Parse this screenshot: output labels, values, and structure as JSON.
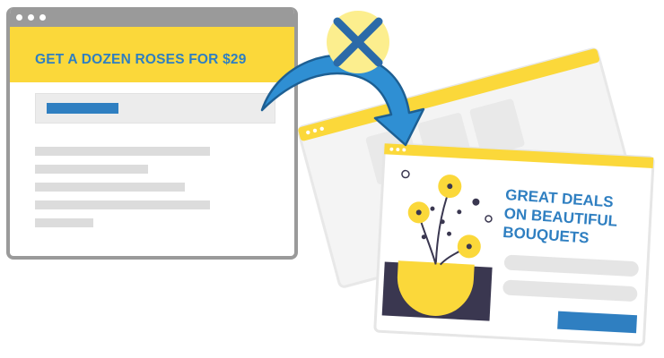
{
  "ad": {
    "headline": "GET A DOZEN ROSES FOR $29"
  },
  "landing": {
    "headline_lines": [
      "GREAT DEALS",
      "ON BEAUTIFUL",
      "BOUQUETS"
    ]
  },
  "icons": {
    "mismatch": "x-icon",
    "redirect": "curved-arrow-icon",
    "flowers": "flower-illustration"
  },
  "colors": {
    "yellow": "#fbd83a",
    "blue": "#2f7fc1",
    "gray": "#9a9a9a",
    "navy": "#2b6aa8",
    "dark": "#3a3750"
  }
}
